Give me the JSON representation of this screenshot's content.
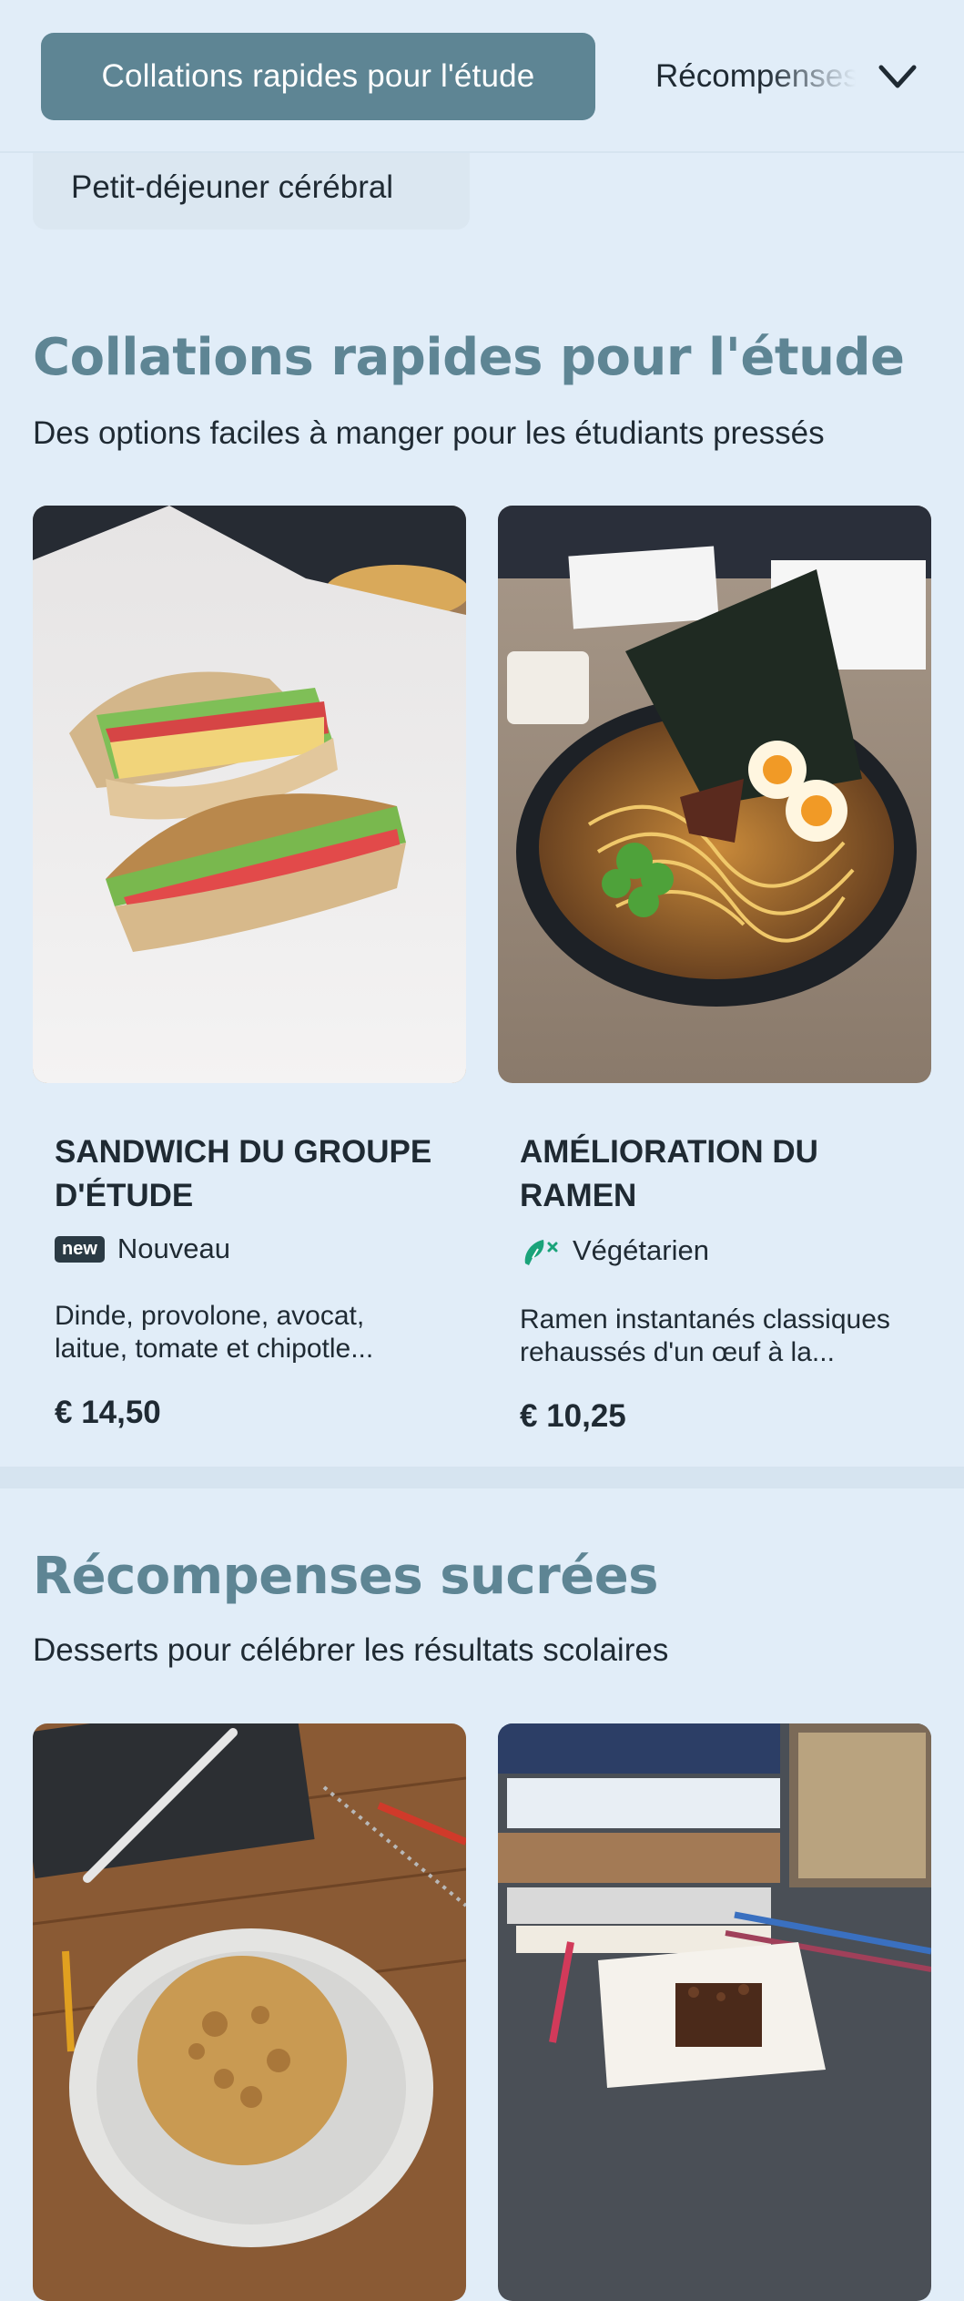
{
  "category_nav": {
    "active_label": "Collations rapides pour l'étude",
    "next_label": "Récompenses sucrées",
    "second_row_label": "Petit-déjeuner cérébral"
  },
  "sections": [
    {
      "title": "Collations rapides pour l'étude",
      "subtitle": "Des options faciles à manger pour les étudiants pressés",
      "items": [
        {
          "name": "Sandwich du groupe d'étude",
          "badge": "new",
          "tag_label": "Nouveau",
          "description": "Dinde, provolone, avocat, laitue, tomate et chipotle...",
          "price": "€ 14,50"
        },
        {
          "name": "Amélioration du ramen",
          "tag_label": "Végétarien",
          "description": "Ramen instantanés classiques rehaussés d'un œuf à la...",
          "price": "€ 10,25"
        }
      ]
    },
    {
      "title": "Récompenses sucrées",
      "subtitle": "Desserts pour célébrer les résultats scolaires"
    }
  ],
  "colors": {
    "background": "#e1edf8",
    "accent": "#5e8594",
    "veg_green": "#1aa37a"
  }
}
